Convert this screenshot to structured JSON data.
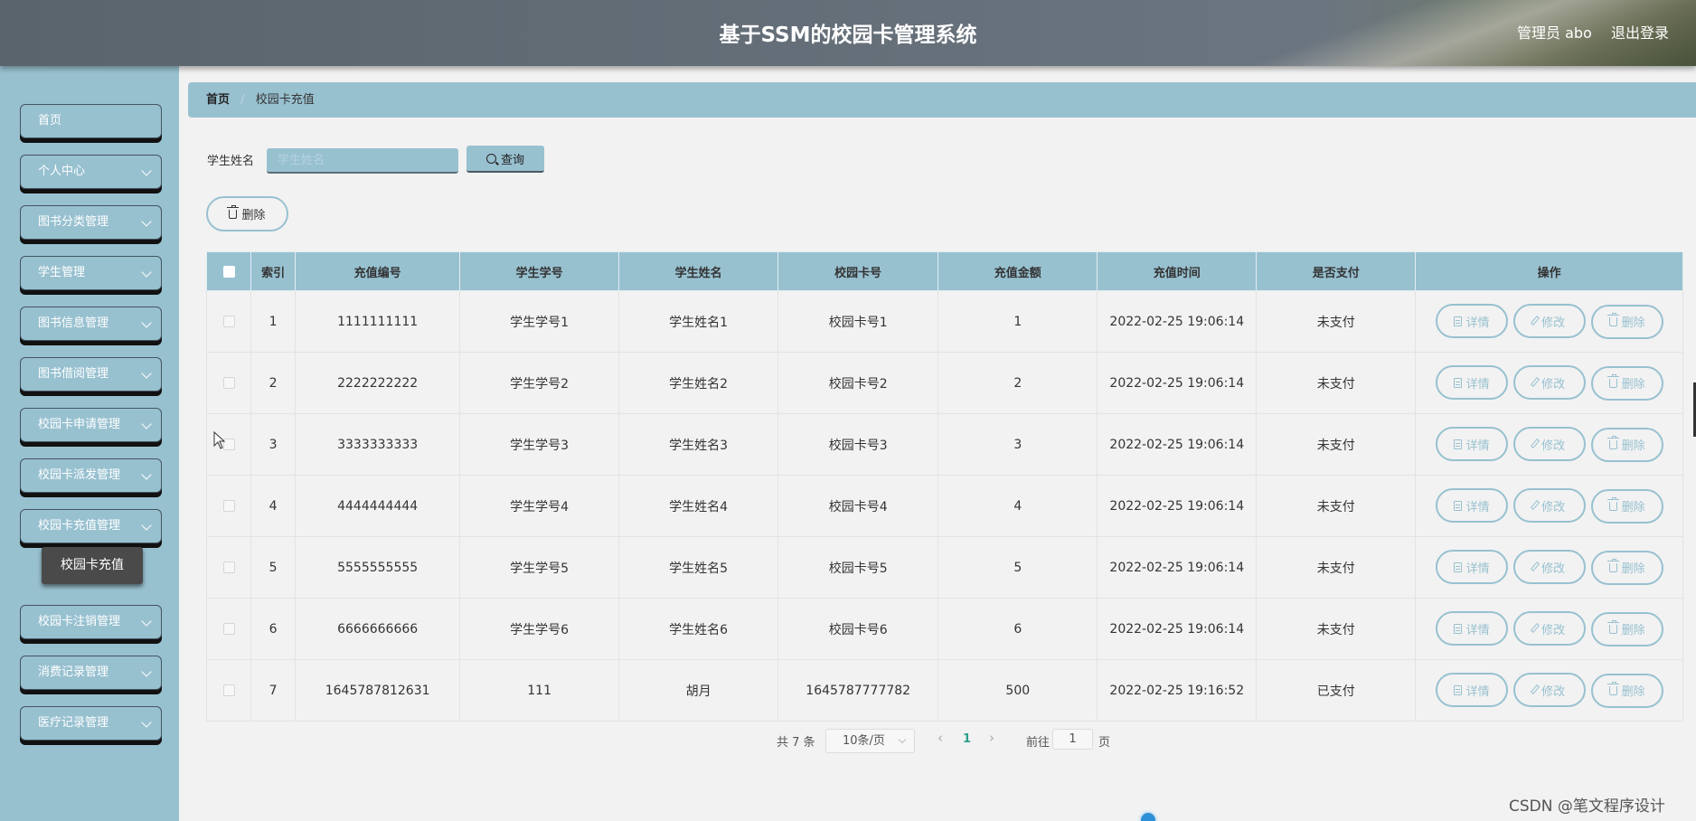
{
  "header": {
    "title": "基于SSM的校园卡管理系统",
    "user": "管理员 abo",
    "logout": "退出登录"
  },
  "sidebar": {
    "items": [
      {
        "label": "首页",
        "has_arrow": false
      },
      {
        "label": "个人中心",
        "has_arrow": true
      },
      {
        "label": "图书分类管理",
        "has_arrow": true
      },
      {
        "label": "学生管理",
        "has_arrow": true
      },
      {
        "label": "图书信息管理",
        "has_arrow": true
      },
      {
        "label": "图书借阅管理",
        "has_arrow": true
      },
      {
        "label": "校园卡申请管理",
        "has_arrow": true
      },
      {
        "label": "校园卡派发管理",
        "has_arrow": true
      },
      {
        "label": "校园卡充值管理",
        "has_arrow": true
      },
      {
        "label": "校园卡注销管理",
        "has_arrow": true
      },
      {
        "label": "消费记录管理",
        "has_arrow": true
      },
      {
        "label": "医疗记录管理",
        "has_arrow": true
      }
    ],
    "submenu": {
      "label": "校园卡充值"
    }
  },
  "breadcrumb": {
    "home": "首页",
    "sep": "/",
    "current": "校园卡充值"
  },
  "search": {
    "label": "学生姓名",
    "placeholder": "学生姓名",
    "button": "查询"
  },
  "actions": {
    "delete": "删除"
  },
  "table": {
    "headers": [
      "索引",
      "充值编号",
      "学生学号",
      "学生姓名",
      "校园卡号",
      "充值金额",
      "充值时间",
      "是否支付",
      "操作"
    ],
    "rows": [
      [
        "1",
        "1111111111",
        "学生学号1",
        "学生姓名1",
        "校园卡号1",
        "1",
        "2022-02-25 19:06:14",
        "未支付"
      ],
      [
        "2",
        "2222222222",
        "学生学号2",
        "学生姓名2",
        "校园卡号2",
        "2",
        "2022-02-25 19:06:14",
        "未支付"
      ],
      [
        "3",
        "3333333333",
        "学生学号3",
        "学生姓名3",
        "校园卡号3",
        "3",
        "2022-02-25 19:06:14",
        "未支付"
      ],
      [
        "4",
        "4444444444",
        "学生学号4",
        "学生姓名4",
        "校园卡号4",
        "4",
        "2022-02-25 19:06:14",
        "未支付"
      ],
      [
        "5",
        "5555555555",
        "学生学号5",
        "学生姓名5",
        "校园卡号5",
        "5",
        "2022-02-25 19:06:14",
        "未支付"
      ],
      [
        "6",
        "6666666666",
        "学生学号6",
        "学生姓名6",
        "校园卡号6",
        "6",
        "2022-02-25 19:06:14",
        "未支付"
      ],
      [
        "7",
        "1645787812631",
        "111",
        "胡月",
        "1645787777782",
        "500",
        "2022-02-25 19:16:52",
        "已支付"
      ]
    ],
    "row_actions": {
      "detail": "详情",
      "edit": "修改",
      "delete": "删除"
    }
  },
  "pagination": {
    "total": "共 7 条",
    "page_size": "10条/页",
    "prev": "‹",
    "current_page": "1",
    "next": "›",
    "goto_label": "前往",
    "goto_value": "1",
    "page_unit": "页"
  },
  "watermark": "CSDN @笔文程序设计",
  "colors": {
    "accent": "#98c1d0",
    "header": "#5f6a73",
    "active_page": "#2c9f8e",
    "submenu": "#4a4a4a"
  }
}
